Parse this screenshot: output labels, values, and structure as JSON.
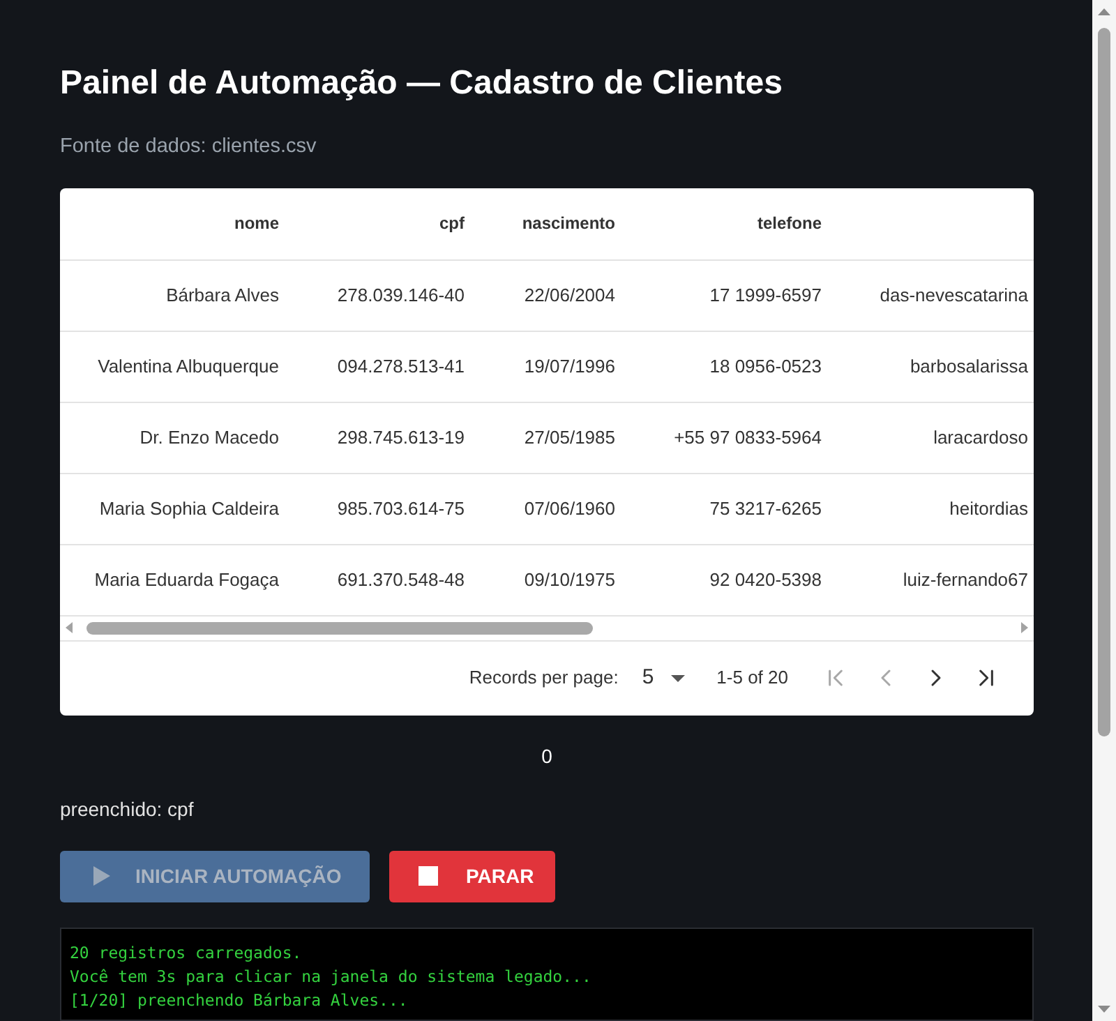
{
  "title": "Painel de Automação — Cadastro de Clientes",
  "data_source": "Fonte de dados: clientes.csv",
  "table": {
    "columns": [
      "nome",
      "cpf",
      "nascimento",
      "telefone"
    ],
    "rows": [
      [
        "Bárbara Alves",
        "278.039.146-40",
        "22/06/2004",
        "17 1999-6597",
        "das-nevescatarina"
      ],
      [
        "Valentina Albuquerque",
        "094.278.513-41",
        "19/07/1996",
        "18 0956-0523",
        "barbosalarissa"
      ],
      [
        "Dr. Enzo Macedo",
        "298.745.613-19",
        "27/05/1985",
        "+55 97 0833-5964",
        "laracardoso"
      ],
      [
        "Maria Sophia Caldeira",
        "985.703.614-75",
        "07/06/1960",
        "75 3217-6265",
        "heitordias"
      ],
      [
        "Maria Eduarda Fogaça",
        "691.370.548-48",
        "09/10/1975",
        "92 0420-5398",
        "luiz-fernando67"
      ]
    ]
  },
  "pagination": {
    "rows_per_page_label": "Records per page:",
    "rows_per_page": "5",
    "range": "1-5 of 20",
    "nav_buttons": [
      {
        "kind": "first",
        "disabled": true
      },
      {
        "kind": "previous",
        "disabled": true
      },
      {
        "kind": "next",
        "disabled": false
      },
      {
        "kind": "last",
        "disabled": false
      }
    ]
  },
  "counter": "0",
  "status": "preenchido: cpf",
  "buttons": [
    {
      "kind": "start",
      "label": "INICIAR AUTOMAÇÃO",
      "disabled": true
    },
    {
      "kind": "stop",
      "label": "PARAR",
      "disabled": false
    }
  ],
  "log": [
    "20 registros carregados.",
    "Você tem 3s para clicar na janela do sistema legado...",
    "[1/20] preenchendo Bárbara Alves..."
  ]
}
